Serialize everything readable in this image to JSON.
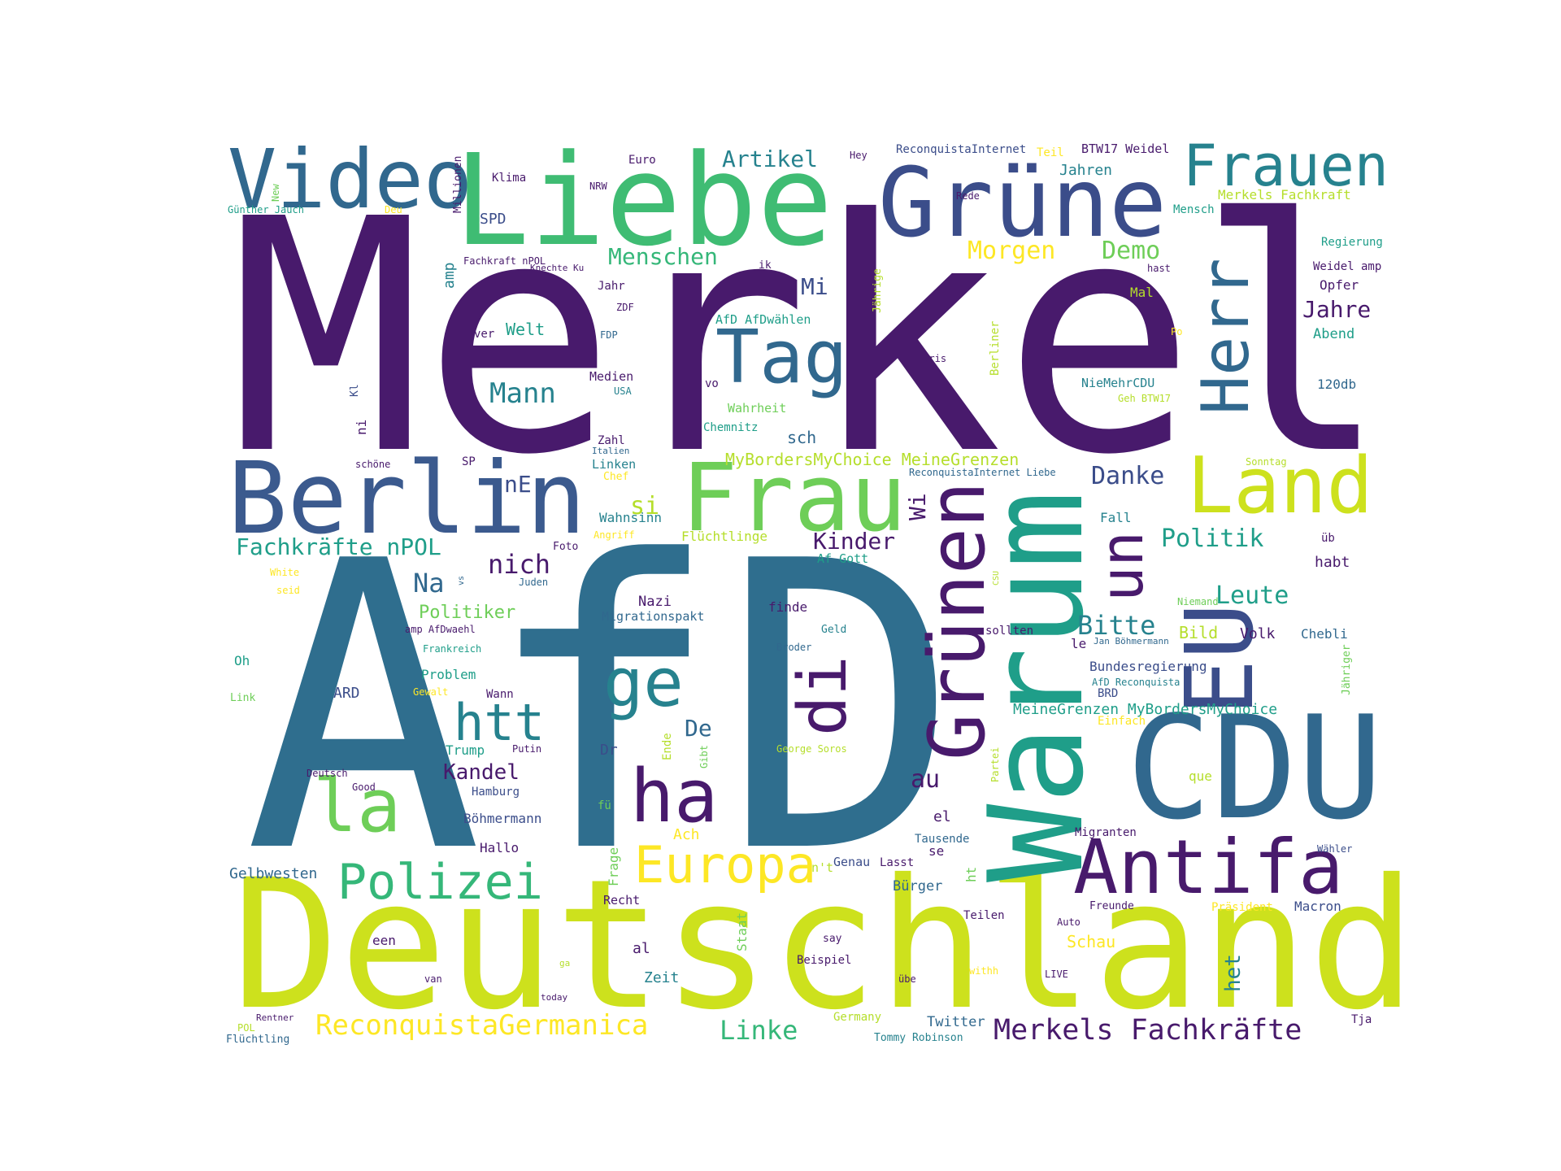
{
  "palette": {
    "dark_purple": "#481a6c",
    "indigo": "#3b4d8a",
    "blue": "#31688e",
    "teal": "#26828e",
    "green_teal": "#1f9e89",
    "green": "#35b779",
    "lime": "#6ece58",
    "yellow_green": "#b5de2b",
    "chartreuse": "#cde11d",
    "yellow": "#fde725",
    "deep_purple": "#440154"
  },
  "words": [
    {
      "text": "Merkel",
      "color": "#481a6c"
    },
    {
      "text": "AfD",
      "color": "#2f6e8e"
    },
    {
      "text": "Deutschland",
      "color": "#cde11d"
    },
    {
      "text": "Liebe",
      "color": "#3fbc73"
    },
    {
      "text": "Video",
      "color": "#31688e"
    },
    {
      "text": "Grüne",
      "color": "#3b4d8a"
    },
    {
      "text": "Frauen",
      "color": "#26828e"
    },
    {
      "text": "Berlin",
      "color": "#3b5a8e"
    },
    {
      "text": "Frau",
      "color": "#6ece58"
    },
    {
      "text": "Land",
      "color": "#cde11d"
    },
    {
      "text": "CDU",
      "color": "#31688e"
    },
    {
      "text": "Warum",
      "color": "#1f9e89"
    },
    {
      "text": "Grünen",
      "color": "#481a6c"
    },
    {
      "text": "EU",
      "color": "#3b4d8a"
    },
    {
      "text": "Tag",
      "color": "#31688e"
    },
    {
      "text": "Herr",
      "color": "#31688e"
    },
    {
      "text": "Antifa",
      "color": "#481a6c"
    },
    {
      "text": "ha",
      "color": "#481a6c"
    },
    {
      "text": "la",
      "color": "#6ece58"
    },
    {
      "text": "Europa",
      "color": "#fde725"
    },
    {
      "text": "Polizei",
      "color": "#35b779"
    },
    {
      "text": "htt",
      "color": "#26828e"
    },
    {
      "text": "ge",
      "color": "#26828e"
    },
    {
      "text": "di",
      "color": "#481a6c"
    },
    {
      "text": "un",
      "color": "#481a6c"
    },
    {
      "text": "ReconquistaGermanica",
      "color": "#fde725"
    },
    {
      "text": "Merkels Fachkräfte",
      "color": "#481a6c"
    },
    {
      "text": "Linke",
      "color": "#35b779"
    },
    {
      "text": "Fachkräfte nPOL",
      "color": "#1f9e89"
    },
    {
      "text": "Artikel",
      "color": "#26828e"
    },
    {
      "text": "Menschen",
      "color": "#35b779"
    },
    {
      "text": "Morgen",
      "color": "#fde725"
    },
    {
      "text": "Demo",
      "color": "#6ece58"
    },
    {
      "text": "Mann",
      "color": "#26828e"
    },
    {
      "text": "Jahre",
      "color": "#481a6c"
    },
    {
      "text": "Mi",
      "color": "#3b4d8a"
    },
    {
      "text": "MyBordersMyChoice MeineGrenzen",
      "color": "#b5de2b"
    },
    {
      "text": "Danke",
      "color": "#3b4d8a"
    },
    {
      "text": "Politik",
      "color": "#1f9e89"
    },
    {
      "text": "Kinder",
      "color": "#481a6c"
    },
    {
      "text": "Bitte",
      "color": "#26828e"
    },
    {
      "text": "Leute",
      "color": "#1f9e89"
    },
    {
      "text": "nich",
      "color": "#481a6c"
    },
    {
      "text": "Na",
      "color": "#31688e"
    },
    {
      "text": "si",
      "color": "#b5de2b"
    },
    {
      "text": "nE",
      "color": "#3b4d8a"
    },
    {
      "text": "Wi",
      "color": "#481a6c"
    },
    {
      "text": "Kandel",
      "color": "#481a6c"
    },
    {
      "text": "De",
      "color": "#31688e"
    },
    {
      "text": "au",
      "color": "#481a6c"
    },
    {
      "text": "Politiker",
      "color": "#6ece58"
    },
    {
      "text": "SPD",
      "color": "#3b4d8a"
    },
    {
      "text": "Welt",
      "color": "#1f9e89"
    },
    {
      "text": "amp",
      "color": "#26828e"
    },
    {
      "text": "Jahren",
      "color": "#26828e"
    },
    {
      "text": "BTW17 Weidel",
      "color": "#481a6c"
    },
    {
      "text": "ReconquistaInternet",
      "color": "#3b4d8a"
    },
    {
      "text": "Teil",
      "color": "#fde725"
    },
    {
      "text": "Merkels Fachkraft",
      "color": "#b5de2b"
    },
    {
      "text": "Mensch",
      "color": "#1f9e89"
    },
    {
      "text": "Regierung",
      "color": "#1f9e89"
    },
    {
      "text": "Weidel amp",
      "color": "#481a6c"
    },
    {
      "text": "Opfer",
      "color": "#481a6c"
    },
    {
      "text": "Abend",
      "color": "#1f9e89"
    },
    {
      "text": "120db",
      "color": "#31688e"
    },
    {
      "text": "Mal",
      "color": "#b5de2b"
    },
    {
      "text": "hast",
      "color": "#481a6c"
    },
    {
      "text": "Po",
      "color": "#fde725"
    },
    {
      "text": "NieMehrCDU",
      "color": "#26828e"
    },
    {
      "text": "Geh BTW17",
      "color": "#b5de2b"
    },
    {
      "text": "Sonntag",
      "color": "#b5de2b"
    },
    {
      "text": "Fall",
      "color": "#26828e"
    },
    {
      "text": "üb",
      "color": "#481a6c"
    },
    {
      "text": "habt",
      "color": "#481a6c"
    },
    {
      "text": "Niemand",
      "color": "#6ece58"
    },
    {
      "text": "Bild",
      "color": "#b5de2b"
    },
    {
      "text": "Volk",
      "color": "#481a6c"
    },
    {
      "text": "Chebli",
      "color": "#31688e"
    },
    {
      "text": "Jähriger",
      "color": "#6ece58"
    },
    {
      "text": "Jan Böhmermann",
      "color": "#31688e"
    },
    {
      "text": "le",
      "color": "#481a6c"
    },
    {
      "text": "sollten",
      "color": "#481a6c"
    },
    {
      "text": "Bundesregierung",
      "color": "#3b4d8a"
    },
    {
      "text": "AfD Reconquista",
      "color": "#26828e"
    },
    {
      "text": "BRD",
      "color": "#3b4d8a"
    },
    {
      "text": "MeineGrenzen MyBordersMyChoice",
      "color": "#1f9e89"
    },
    {
      "text": "Einfach",
      "color": "#fde725"
    },
    {
      "text": "que",
      "color": "#b5de2b"
    },
    {
      "text": "Migranten",
      "color": "#481a6c"
    },
    {
      "text": "Wähler",
      "color": "#3b4d8a"
    },
    {
      "text": "Macron",
      "color": "#3b4d8a"
    },
    {
      "text": "Präsident",
      "color": "#fde725"
    },
    {
      "text": "Tja",
      "color": "#481a6c"
    },
    {
      "text": "Schau",
      "color": "#fde725"
    },
    {
      "text": "Auto",
      "color": "#481a6c"
    },
    {
      "text": "Freunde",
      "color": "#481a6c"
    },
    {
      "text": "het",
      "color": "#26828e"
    },
    {
      "text": "LIVE",
      "color": "#481a6c"
    },
    {
      "text": "Twitter",
      "color": "#31688e"
    },
    {
      "text": "Tommy Robinson",
      "color": "#26828e"
    },
    {
      "text": "Germany",
      "color": "#b5de2b"
    },
    {
      "text": "übe",
      "color": "#481a6c"
    },
    {
      "text": "withh",
      "color": "#fde725"
    },
    {
      "text": "Beispiel",
      "color": "#481a6c"
    },
    {
      "text": "say",
      "color": "#481a6c"
    },
    {
      "text": "Teilen",
      "color": "#481a6c"
    },
    {
      "text": "Bürger",
      "color": "#31688e"
    },
    {
      "text": "Genau",
      "color": "#3b4d8a"
    },
    {
      "text": "Lasst",
      "color": "#481a6c"
    },
    {
      "text": "se",
      "color": "#481a6c"
    },
    {
      "text": "Tausende",
      "color": "#31688e"
    },
    {
      "text": "el",
      "color": "#481a6c"
    },
    {
      "text": "ht",
      "color": "#6ece58"
    },
    {
      "text": "n't",
      "color": "#b5de2b"
    },
    {
      "text": "Partei",
      "color": "#b5de2b"
    },
    {
      "text": "Staat",
      "color": "#6ece58"
    },
    {
      "text": "George Soros",
      "color": "#b5de2b"
    },
    {
      "text": "Geld",
      "color": "#26828e"
    },
    {
      "text": "Broder",
      "color": "#31688e"
    },
    {
      "text": "finde",
      "color": "#481a6c"
    },
    {
      "text": "Nazi",
      "color": "#481a6c"
    },
    {
      "text": "Migrationspakt",
      "color": "#31688e"
    },
    {
      "text": "Af Gott",
      "color": "#1f9e89"
    },
    {
      "text": "Flüchtlinge",
      "color": "#b5de2b"
    },
    {
      "text": "Angriff",
      "color": "#fde725"
    },
    {
      "text": "Wahnsinn",
      "color": "#26828e"
    },
    {
      "text": "Foto",
      "color": "#481a6c"
    },
    {
      "text": "Juden",
      "color": "#31688e"
    },
    {
      "text": "Chef",
      "color": "#fde725"
    },
    {
      "text": "Linken",
      "color": "#26828e"
    },
    {
      "text": "Italien",
      "color": "#31688e"
    },
    {
      "text": "Zahl",
      "color": "#481a6c"
    },
    {
      "text": "sch",
      "color": "#31688e"
    },
    {
      "text": "Chemnitz",
      "color": "#1f9e89"
    },
    {
      "text": "Wahrheit",
      "color": "#6ece58"
    },
    {
      "text": "vo",
      "color": "#481a6c"
    },
    {
      "text": "Medien",
      "color": "#481a6c"
    },
    {
      "text": "USA",
      "color": "#26828e"
    },
    {
      "text": "FDP",
      "color": "#31688e"
    },
    {
      "text": "ZDF",
      "color": "#481a6c"
    },
    {
      "text": "AfD AfDwählen",
      "color": "#1f9e89"
    },
    {
      "text": "Jahr",
      "color": "#481a6c"
    },
    {
      "text": "ik",
      "color": "#481a6c"
    },
    {
      "text": "Jährige",
      "color": "#b5de2b"
    },
    {
      "text": "Paris",
      "color": "#481a6c"
    },
    {
      "text": "Berliner",
      "color": "#b5de2b"
    },
    {
      "text": "Rede",
      "color": "#481a6c"
    },
    {
      "text": "Hey",
      "color": "#481a6c"
    },
    {
      "text": "Euro",
      "color": "#481a6c"
    },
    {
      "text": "Klima",
      "color": "#481a6c"
    },
    {
      "text": "NRW",
      "color": "#481a6c"
    },
    {
      "text": "Millionen",
      "color": "#481a6c"
    },
    {
      "text": "New",
      "color": "#6ece58"
    },
    {
      "text": "Günther Jauch",
      "color": "#1f9e89"
    },
    {
      "text": "Deu",
      "color": "#fde725"
    },
    {
      "text": "Fachkraft nPOL",
      "color": "#481a6c"
    },
    {
      "text": "Knechte Ku",
      "color": "#481a6c"
    },
    {
      "text": "ver",
      "color": "#481a6c"
    },
    {
      "text": "Kl",
      "color": "#3b4d8a"
    },
    {
      "text": "ni",
      "color": "#481a6c"
    },
    {
      "text": "schöne",
      "color": "#481a6c"
    },
    {
      "text": "SP",
      "color": "#481a6c"
    },
    {
      "text": "ReconquistaInternet Liebe",
      "color": "#31688e"
    },
    {
      "text": "White",
      "color": "#fde725"
    },
    {
      "text": "seid",
      "color": "#fde725"
    },
    {
      "text": "vs",
      "color": "#31688e"
    },
    {
      "text": "amp AfDwaehl",
      "color": "#481a6c"
    },
    {
      "text": "Frankreich",
      "color": "#1f9e89"
    },
    {
      "text": "Oh",
      "color": "#1f9e89"
    },
    {
      "text": "Problem",
      "color": "#1f9e89"
    },
    {
      "text": "Link",
      "color": "#6ece58"
    },
    {
      "text": "Gewalt",
      "color": "#fde725"
    },
    {
      "text": "Wann",
      "color": "#481a6c"
    },
    {
      "text": "ARD",
      "color": "#3b4d8a"
    },
    {
      "text": "Trump",
      "color": "#1f9e89"
    },
    {
      "text": "Putin",
      "color": "#481a6c"
    },
    {
      "text": "Dr",
      "color": "#3b4d8a"
    },
    {
      "text": "Ende",
      "color": "#b5de2b"
    },
    {
      "text": "Gibt",
      "color": "#6ece58"
    },
    {
      "text": "Deutsch",
      "color": "#481a6c"
    },
    {
      "text": "Good",
      "color": "#481a6c"
    },
    {
      "text": "Hamburg",
      "color": "#3b4d8a"
    },
    {
      "text": "fü",
      "color": "#6ece58"
    },
    {
      "text": "Böhmermann",
      "color": "#3b4d8a"
    },
    {
      "text": "Ach",
      "color": "#fde725"
    },
    {
      "text": "Frage",
      "color": "#6ece58"
    },
    {
      "text": "Hallo",
      "color": "#481a6c"
    },
    {
      "text": "Gelbwesten",
      "color": "#31688e"
    },
    {
      "text": "Recht",
      "color": "#481a6c"
    },
    {
      "text": "een",
      "color": "#481a6c"
    },
    {
      "text": "al",
      "color": "#481a6c"
    },
    {
      "text": "Zeit",
      "color": "#26828e"
    },
    {
      "text": "ga",
      "color": "#b5de2b"
    },
    {
      "text": "van",
      "color": "#481a6c"
    },
    {
      "text": "today",
      "color": "#481a6c"
    },
    {
      "text": "Rentner",
      "color": "#481a6c"
    },
    {
      "text": "POL",
      "color": "#b5de2b"
    },
    {
      "text": "Flüchtling",
      "color": "#31688e"
    },
    {
      "text": "CSU",
      "color": "#b5de2b"
    }
  ]
}
